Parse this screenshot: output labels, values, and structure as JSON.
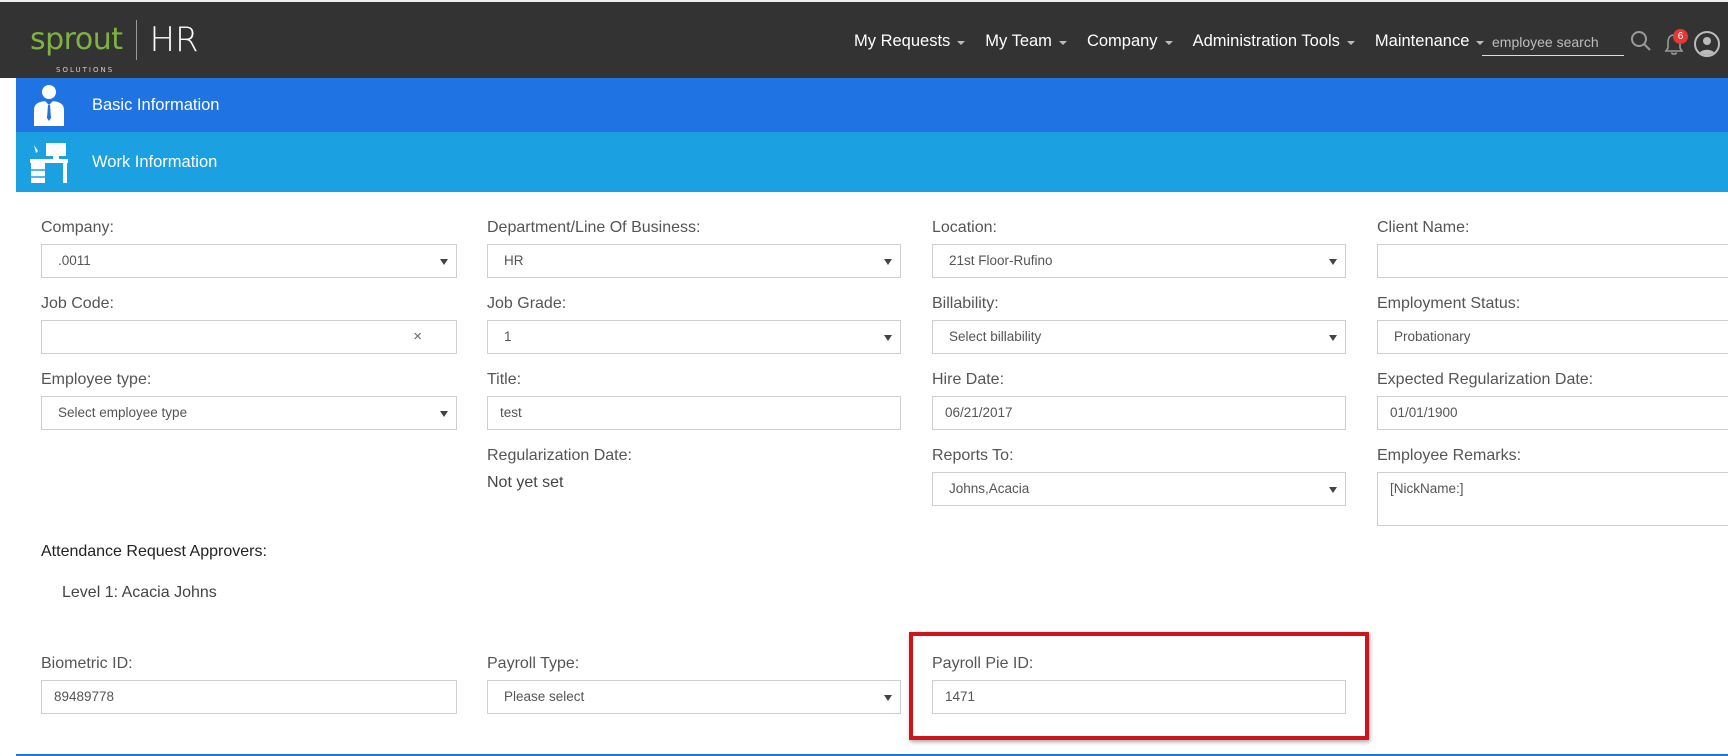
{
  "header": {
    "logo_text": "sprout",
    "logo_sub": "SOLUTIONS",
    "app_name": "HR",
    "nav": [
      {
        "label": "My Requests"
      },
      {
        "label": "My Team"
      },
      {
        "label": "Company"
      },
      {
        "label": "Administration Tools"
      },
      {
        "label": "Maintenance"
      }
    ],
    "search_placeholder": "employee search",
    "notification_count": "6",
    "icons": [
      "search-icon",
      "bell-icon",
      "user-avatar-icon"
    ]
  },
  "sections": {
    "basic": "Basic Information",
    "work": "Work Information"
  },
  "form": {
    "company": {
      "label": "Company:",
      "value": ".0011"
    },
    "department": {
      "label": "Department/Line Of Business:",
      "value": "HR"
    },
    "location": {
      "label": "Location:",
      "value": "21st Floor-Rufino"
    },
    "client_name": {
      "label": "Client Name:",
      "value": ""
    },
    "job_code": {
      "label": "Job Code:",
      "value": "",
      "clear": "×"
    },
    "job_grade": {
      "label": "Job Grade:",
      "value": "1"
    },
    "billability": {
      "label": "Billability:",
      "value": "Select billability"
    },
    "employment_status": {
      "label": "Employment Status:",
      "value": "Probationary"
    },
    "employee_type": {
      "label": "Employee type:",
      "value": "Select employee type"
    },
    "title": {
      "label": "Title:",
      "value": "test"
    },
    "hire_date": {
      "label": "Hire Date:",
      "value": "06/21/2017"
    },
    "expected_regularization": {
      "label": "Expected Regularization Date:",
      "value": "01/01/1900"
    },
    "regularization_date": {
      "label": "Regularization Date:",
      "value": "Not yet set"
    },
    "reports_to": {
      "label": "Reports To:",
      "value": "Johns,Acacia"
    },
    "employee_remarks": {
      "label": "Employee Remarks:",
      "value": "[NickName:]"
    },
    "approvers_title": "Attendance Request Approvers:",
    "approver_level_1": "Level 1: Acacia Johns",
    "biometric_id": {
      "label": "Biometric ID:",
      "value": "89489778"
    },
    "payroll_type": {
      "label": "Payroll Type:",
      "value": "Please select"
    },
    "payroll_pie_id": {
      "label": "Payroll Pie ID:",
      "value": "1471"
    }
  },
  "colors": {
    "topbar": "#333333",
    "basic_section": "#1f73e2",
    "work_section": "#1ba0e2",
    "highlight": "#d0141c",
    "logo_green": "#7cb342"
  }
}
